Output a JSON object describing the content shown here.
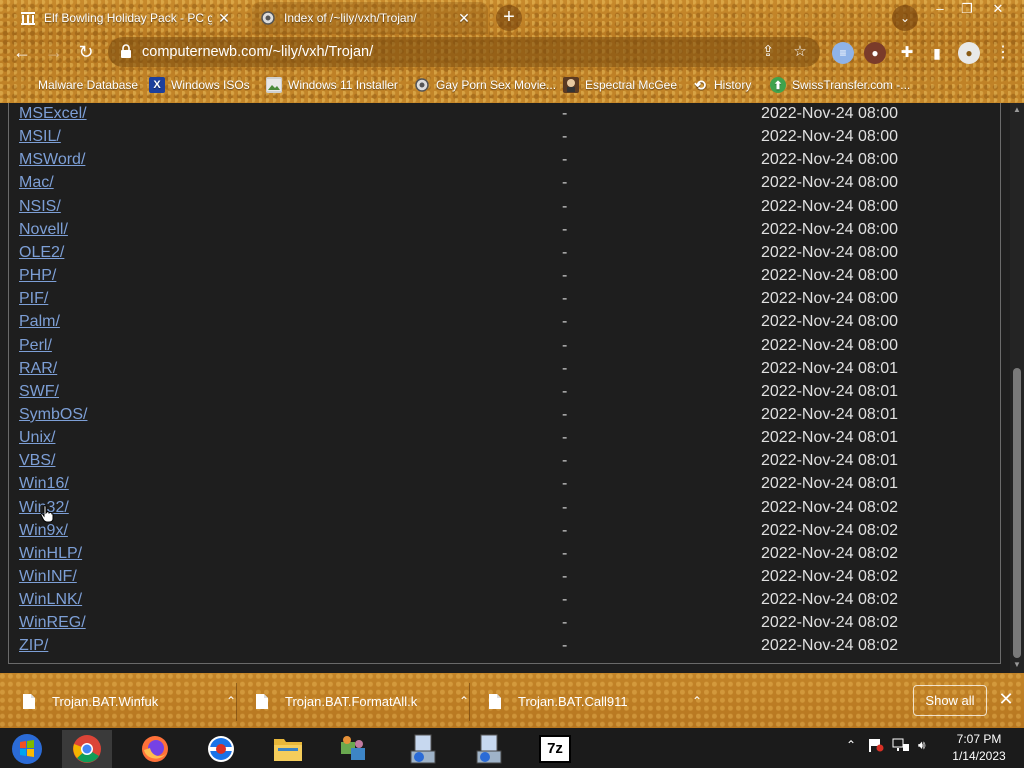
{
  "tabs": [
    {
      "title": "Elf Bowling Holiday Pack - PC gam",
      "icon": "museum-icon",
      "active": false
    },
    {
      "title": "Index of /~lily/vxh/Trojan/",
      "icon": "gear-icon",
      "active": true
    }
  ],
  "address": {
    "url": "computernewb.com/~lily/vxh/Trojan/"
  },
  "bookmarks": [
    {
      "label": "Malware Database",
      "icon": "blank-icon"
    },
    {
      "label": "Windows ISOs",
      "icon": "x-icon"
    },
    {
      "label": "Windows 11 Installer",
      "icon": "image-icon"
    },
    {
      "label": "Gay Porn Sex Movie...",
      "icon": "gear-icon"
    },
    {
      "label": "Espectral McGee",
      "icon": "character-icon"
    },
    {
      "label": "History",
      "icon": "history-icon"
    },
    {
      "label": "SwissTransfer.com -...",
      "icon": "swisstransfer-icon"
    }
  ],
  "listing": [
    {
      "name": "MSExcel/",
      "size": "-",
      "date": "2022-Nov-24 08:00"
    },
    {
      "name": "MSIL/",
      "size": "-",
      "date": "2022-Nov-24 08:00"
    },
    {
      "name": "MSWord/",
      "size": "-",
      "date": "2022-Nov-24 08:00"
    },
    {
      "name": "Mac/",
      "size": "-",
      "date": "2022-Nov-24 08:00"
    },
    {
      "name": "NSIS/",
      "size": "-",
      "date": "2022-Nov-24 08:00"
    },
    {
      "name": "Novell/",
      "size": "-",
      "date": "2022-Nov-24 08:00"
    },
    {
      "name": "OLE2/",
      "size": "-",
      "date": "2022-Nov-24 08:00"
    },
    {
      "name": "PHP/",
      "size": "-",
      "date": "2022-Nov-24 08:00"
    },
    {
      "name": "PIF/",
      "size": "-",
      "date": "2022-Nov-24 08:00"
    },
    {
      "name": "Palm/",
      "size": "-",
      "date": "2022-Nov-24 08:00"
    },
    {
      "name": "Perl/",
      "size": "-",
      "date": "2022-Nov-24 08:00"
    },
    {
      "name": "RAR/",
      "size": "-",
      "date": "2022-Nov-24 08:01"
    },
    {
      "name": "SWF/",
      "size": "-",
      "date": "2022-Nov-24 08:01"
    },
    {
      "name": "SymbOS/",
      "size": "-",
      "date": "2022-Nov-24 08:01"
    },
    {
      "name": "Unix/",
      "size": "-",
      "date": "2022-Nov-24 08:01"
    },
    {
      "name": "VBS/",
      "size": "-",
      "date": "2022-Nov-24 08:01"
    },
    {
      "name": "Win16/",
      "size": "-",
      "date": "2022-Nov-24 08:01"
    },
    {
      "name": "Win32/",
      "size": "-",
      "date": "2022-Nov-24 08:02"
    },
    {
      "name": "Win9x/",
      "size": "-",
      "date": "2022-Nov-24 08:02"
    },
    {
      "name": "WinHLP/",
      "size": "-",
      "date": "2022-Nov-24 08:02"
    },
    {
      "name": "WinINF/",
      "size": "-",
      "date": "2022-Nov-24 08:02"
    },
    {
      "name": "WinLNK/",
      "size": "-",
      "date": "2022-Nov-24 08:02"
    },
    {
      "name": "WinREG/",
      "size": "-",
      "date": "2022-Nov-24 08:02"
    },
    {
      "name": "ZIP/",
      "size": "-",
      "date": "2022-Nov-24 08:02"
    }
  ],
  "downloads": {
    "items": [
      {
        "name": "Trojan.BAT.Winfuk"
      },
      {
        "name": "Trojan.BAT.FormatAll.k"
      },
      {
        "name": "Trojan.BAT.Call911"
      }
    ],
    "show_all_label": "Show all"
  },
  "taskbar": {
    "apps": [
      "windows-start-icon",
      "chrome-icon",
      "firefox-icon",
      "opera-icon",
      "file-explorer-icon",
      "network-app-icon",
      "installer-icon",
      "installer-icon",
      "7zip-icon"
    ],
    "sevenzip_label": "7z"
  },
  "clock": {
    "time": "7:07 PM",
    "date": "1/14/2023"
  },
  "colors": {
    "link": "#7d9fd6",
    "page_bg": "#1e1e1e",
    "theme": "#c48629"
  }
}
